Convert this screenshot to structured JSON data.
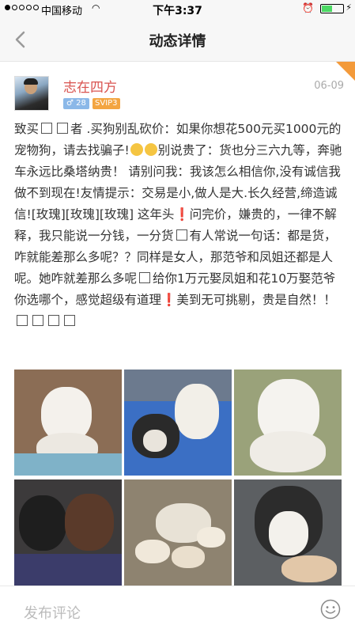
{
  "status_bar": {
    "carrier": "中国移动",
    "time": "下午3:37",
    "battery_level": 0.45
  },
  "nav": {
    "title": "动态详情"
  },
  "post": {
    "username": "志在四方",
    "date": "06-09",
    "gender_badge": "♂ 28",
    "vip_badge": "SVIP3",
    "text": [
      "致买",
      "者 .买狗别乱砍价：如果你想花500元买1000元的宠物狗，请去找骗子!",
      "别说贵了：货也分三六九等，奔驰车永远比桑塔纳贵！ 请别问我：我该怎么相信你,没有诚信我做不到现在!友情提示：交易是小,做人是大.长久经营,缔造诚信![玫瑰][玫瑰][玫瑰] 这年头",
      "问完价，嫌贵的，一律不解释，我只能说一分钱，一分货",
      "有人常说一句话：都是货，咋就能差那么多呢？？同样是女人，那范爷和凤姐还都是人呢。她咋就差那么多呢",
      "给你1万元娶凤姐和花10万娶范爷 你选哪个，感觉超级有道理",
      "美到无可挑剔，贵是自然！！"
    ],
    "exclamation": "❗"
  },
  "photos": [
    {
      "name": "photo-white-puppy-1"
    },
    {
      "name": "photo-husky-puppies"
    },
    {
      "name": "photo-white-puppy-2"
    },
    {
      "name": "photo-dark-puppies"
    },
    {
      "name": "photo-litter-puppies"
    },
    {
      "name": "photo-husky-puppy"
    }
  ],
  "comment_bar": {
    "placeholder": "发布评论"
  },
  "icons": {
    "back": "chevron-left-icon",
    "smile": "smile-icon"
  },
  "colors": {
    "username": "#d9534f",
    "vip": "#f3a541",
    "gender": "#8bb8e8",
    "corner": "#f39a3a"
  }
}
